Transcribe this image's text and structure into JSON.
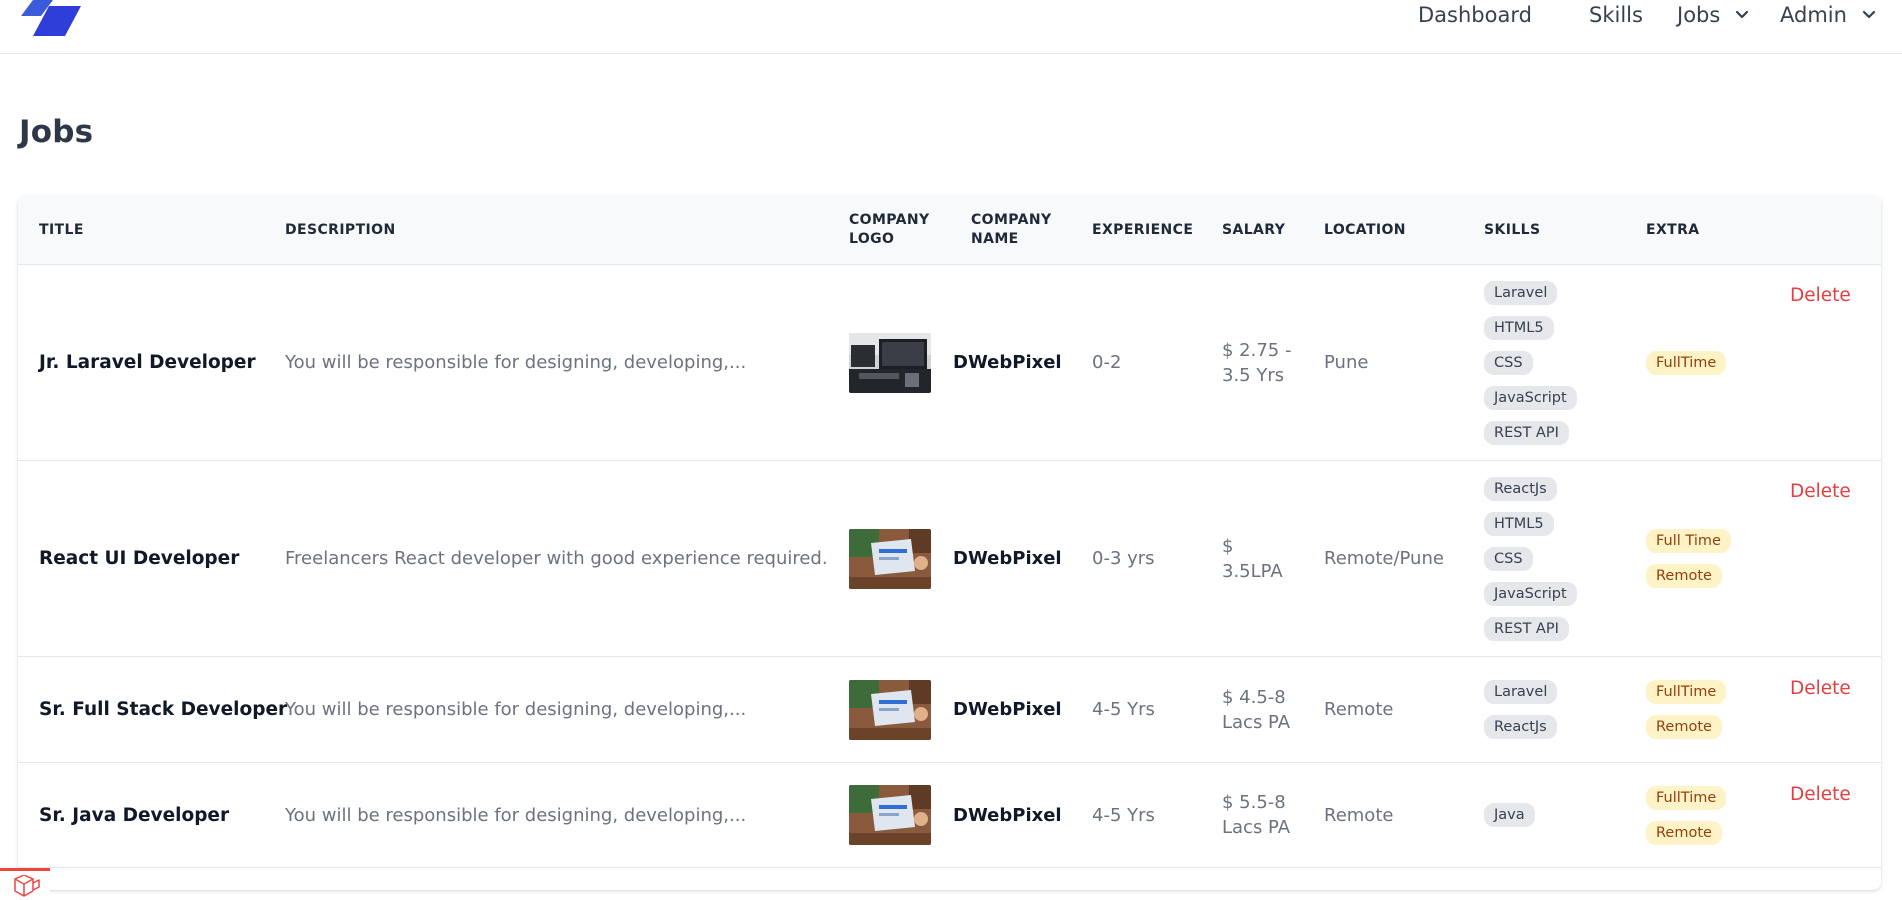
{
  "nav": {
    "dashboard": "Dashboard",
    "skills": "Skills",
    "jobs": "Jobs",
    "admin": "Admin"
  },
  "page": {
    "title": "Jobs"
  },
  "table": {
    "headers": {
      "title": "Title",
      "description": "Description",
      "company_logo_1": "Company",
      "company_logo_2": "Logo",
      "company_name_1": "Company",
      "company_name_2": "Name",
      "experience": "Experience",
      "salary": "Salary",
      "location": "Location",
      "skills": "Skills",
      "extra": "Extra"
    },
    "rows": [
      {
        "title": "Jr. Laravel Developer",
        "description": "You will be responsible for designing, developing,...",
        "company": "DWebPixel",
        "experience": "0-2",
        "salary": "$ 2.75 - 3.5 Yrs",
        "location": "Pune",
        "skills": [
          "Laravel",
          "HTML5",
          "CSS",
          "JavaScript",
          "REST API"
        ],
        "extra": [
          "FullTime"
        ],
        "action": "Delete"
      },
      {
        "title": "React UI Developer",
        "description": "Freelancers React developer with good experience required.",
        "company": "DWebPixel",
        "experience": "0-3 yrs",
        "salary": "$ 3.5LPA",
        "location": "Remote/Pune",
        "skills": [
          "ReactJs",
          "HTML5",
          "CSS",
          "JavaScript",
          "REST API"
        ],
        "extra": [
          "Full Time",
          "Remote"
        ],
        "action": "Delete"
      },
      {
        "title": "Sr. Full Stack Developer",
        "description": "You will be responsible for designing, developing,...",
        "company": "DWebPixel",
        "experience": "4-5 Yrs",
        "salary": "$ 4.5-8 Lacs PA",
        "location": "Remote",
        "skills": [
          "Laravel",
          "ReactJs"
        ],
        "extra": [
          "FullTime",
          "Remote"
        ],
        "action": "Delete"
      },
      {
        "title": "Sr. Java Developer",
        "description": "You will be responsible for designing, developing,...",
        "company": "DWebPixel",
        "experience": "4-5 Yrs",
        "salary": "$ 5.5-8 Lacs PA",
        "location": "Remote",
        "skills": [
          "Java"
        ],
        "extra": [
          "FullTime",
          "Remote"
        ],
        "action": "Delete"
      }
    ]
  },
  "colors": {
    "delete": "#e53e3e",
    "extra_badge_bg": "#fef3c7",
    "skill_badge_bg": "#e5e7eb",
    "logo_blue": "#2d3ee8"
  }
}
